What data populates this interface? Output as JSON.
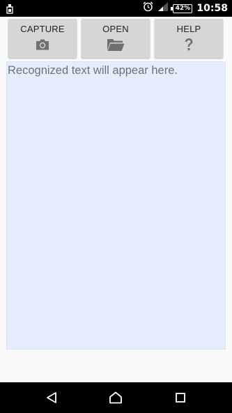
{
  "status_bar": {
    "battery_percent": "42%",
    "time": "10:58",
    "icons": [
      "sim-icon",
      "alarm-icon",
      "signal-icon",
      "battery-icon"
    ]
  },
  "toolbar": {
    "buttons": [
      {
        "label": "CAPTURE",
        "icon": "camera-icon"
      },
      {
        "label": "OPEN",
        "icon": "folder-icon"
      },
      {
        "label": "HELP",
        "icon": "help-icon"
      }
    ]
  },
  "main": {
    "placeholder": "Recognized text will appear here."
  },
  "colors": {
    "button_bg": "#d6d6d6",
    "text_area_bg": "#e4eefe",
    "icon_gray": "#707070"
  },
  "nav_bar": {
    "buttons": [
      "back-icon",
      "home-icon",
      "recents-icon"
    ]
  }
}
